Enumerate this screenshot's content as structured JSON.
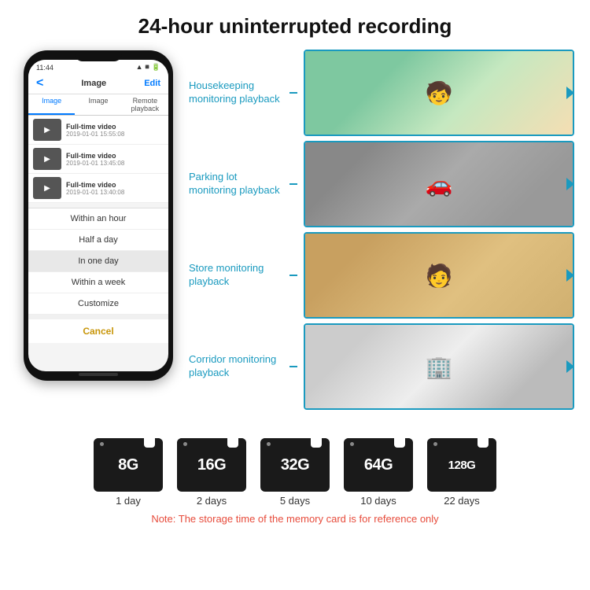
{
  "header": {
    "title": "24-hour uninterrupted recording"
  },
  "phone": {
    "status_time": "11:44",
    "nav_title": "Image",
    "nav_back": "<",
    "nav_edit": "Edit",
    "tabs": [
      "Image",
      "Image",
      "Remote playback"
    ],
    "items": [
      {
        "title": "Full-time video",
        "date": "2019-01-01 15:55:08"
      },
      {
        "title": "Full-time video",
        "date": "2019-01-01 13:45:08"
      },
      {
        "title": "Full-time video",
        "date": "2019-01-01 13:40:08"
      }
    ],
    "dropdown": [
      "Within an hour",
      "Half a day",
      "In one day",
      "Within a week",
      "Customize"
    ],
    "cancel": "Cancel"
  },
  "playback_items": [
    {
      "label": "Housekeeping monitoring playback",
      "img_type": "housekeeping",
      "emoji": "🧒"
    },
    {
      "label": "Parking lot monitoring playback",
      "img_type": "parking",
      "emoji": "🚗"
    },
    {
      "label": "Store monitoring playback",
      "img_type": "store",
      "emoji": "🧑"
    },
    {
      "label": "Corridor monitoring playback",
      "img_type": "corridor",
      "emoji": "🏢"
    }
  ],
  "sdcards": [
    {
      "size": "8G",
      "days": "1 day"
    },
    {
      "size": "16G",
      "days": "2 days"
    },
    {
      "size": "32G",
      "days": "5 days"
    },
    {
      "size": "64G",
      "days": "10 days"
    },
    {
      "size": "128G",
      "days": "22 days"
    }
  ],
  "note": "Note: The storage time of the memory card is for reference only",
  "colors": {
    "accent": "#1a9abf",
    "title": "#111111",
    "note_red": "#e74c3c"
  }
}
